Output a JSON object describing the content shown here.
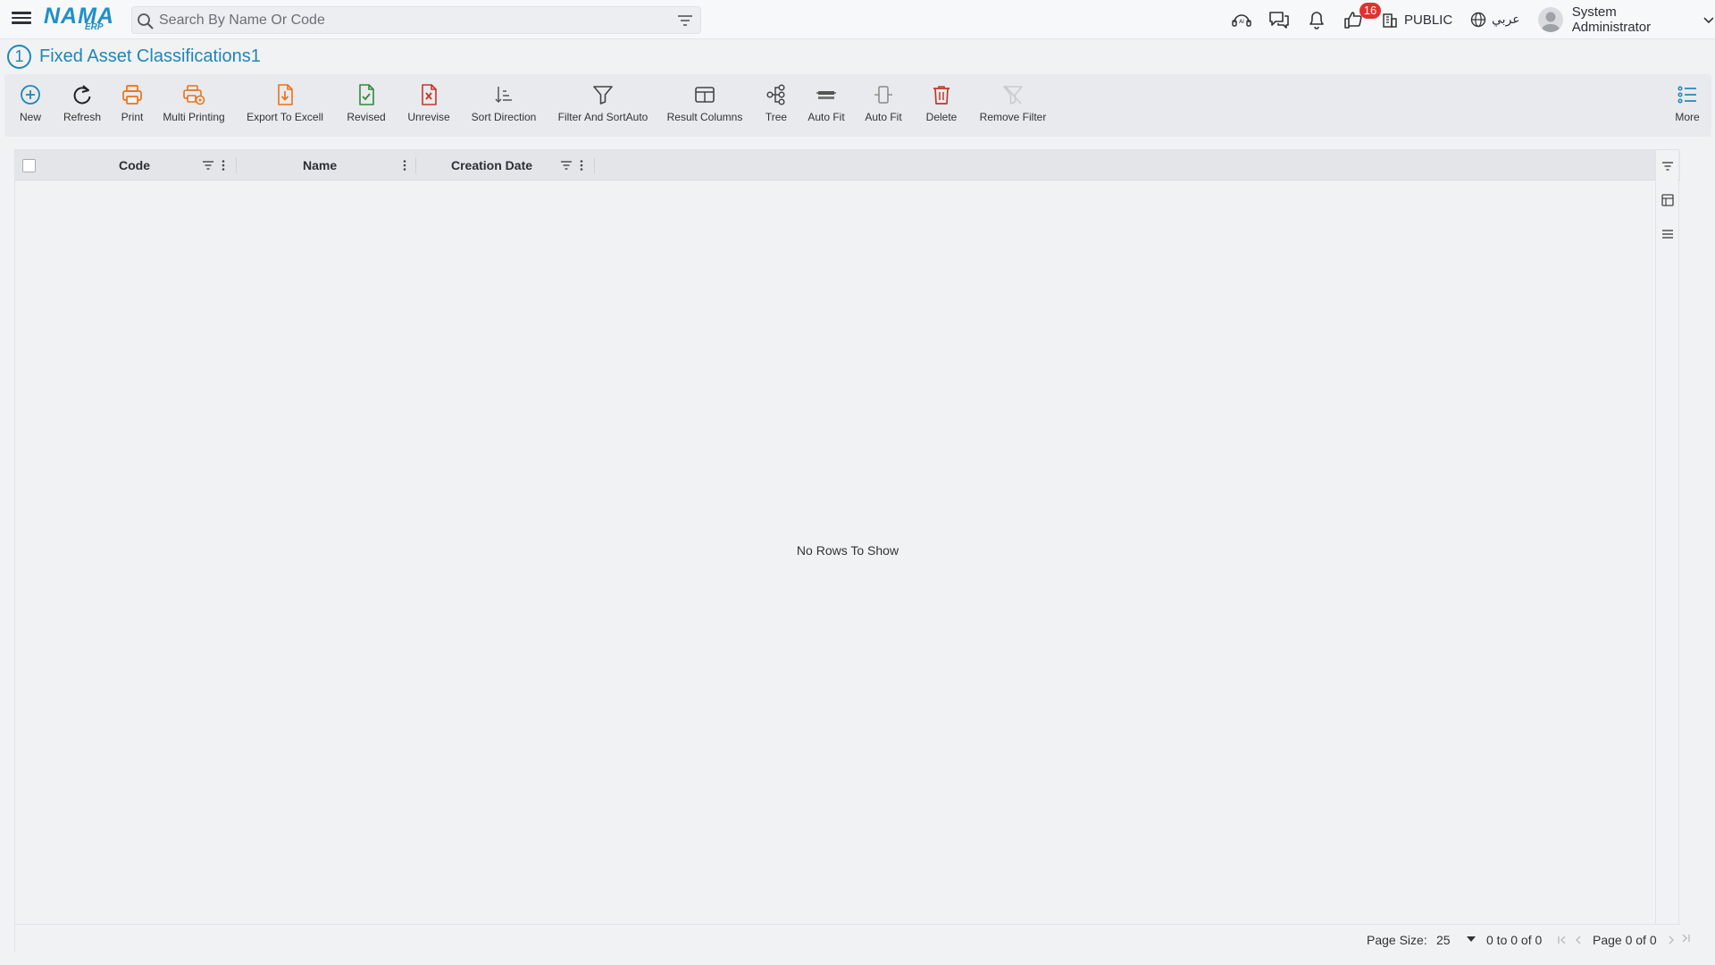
{
  "header": {
    "logo_text": "NAMA",
    "logo_sub": "ERP",
    "search_placeholder": "Search By Name Or Code",
    "notification_count": "16",
    "branch_label": "PUBLIC",
    "language_label": "عربي",
    "user_name": "System Administrator"
  },
  "page": {
    "tab_number": "1",
    "title": "Fixed Asset Classifications1"
  },
  "toolbar": {
    "items": [
      {
        "label": "New",
        "icon": "plus-circle-icon"
      },
      {
        "label": "Refresh",
        "icon": "refresh-icon"
      },
      {
        "label": "Print",
        "icon": "printer-icon"
      },
      {
        "label": "Multi Printing",
        "icon": "multi-printer-icon"
      },
      {
        "label": "Export To Excell",
        "icon": "export-excel-icon"
      },
      {
        "label": "Revised",
        "icon": "revised-document-icon"
      },
      {
        "label": "Unrevise",
        "icon": "unrevise-document-icon"
      },
      {
        "label": "Sort Direction",
        "icon": "sort-direction-icon"
      },
      {
        "label": "Filter And SortAuto",
        "icon": "funnel-icon"
      },
      {
        "label": "Result Columns",
        "icon": "columns-icon"
      },
      {
        "label": "Tree",
        "icon": "tree-icon"
      },
      {
        "label": "Auto Fit",
        "icon": "auto-fit-rows-icon"
      },
      {
        "label": "Auto Fit",
        "icon": "auto-fit-columns-icon"
      },
      {
        "label": "Delete",
        "icon": "trash-icon"
      },
      {
        "label": "Remove Filter",
        "icon": "remove-filter-icon"
      },
      {
        "label": "More",
        "icon": "list-icon"
      }
    ]
  },
  "grid": {
    "columns": [
      "Code",
      "Name",
      "Creation Date"
    ],
    "empty_message": "No Rows To Show",
    "footer": {
      "page_size_label": "Page Size:",
      "page_size_value": "25",
      "range_text": "0 to 0 of 0",
      "page_text": "Page 0 of 0"
    }
  },
  "colors": {
    "accent": "#1f87b8",
    "orange": "#e8731a",
    "green": "#2e8b3d",
    "red": "#c0392b",
    "badge": "#e0312f"
  }
}
